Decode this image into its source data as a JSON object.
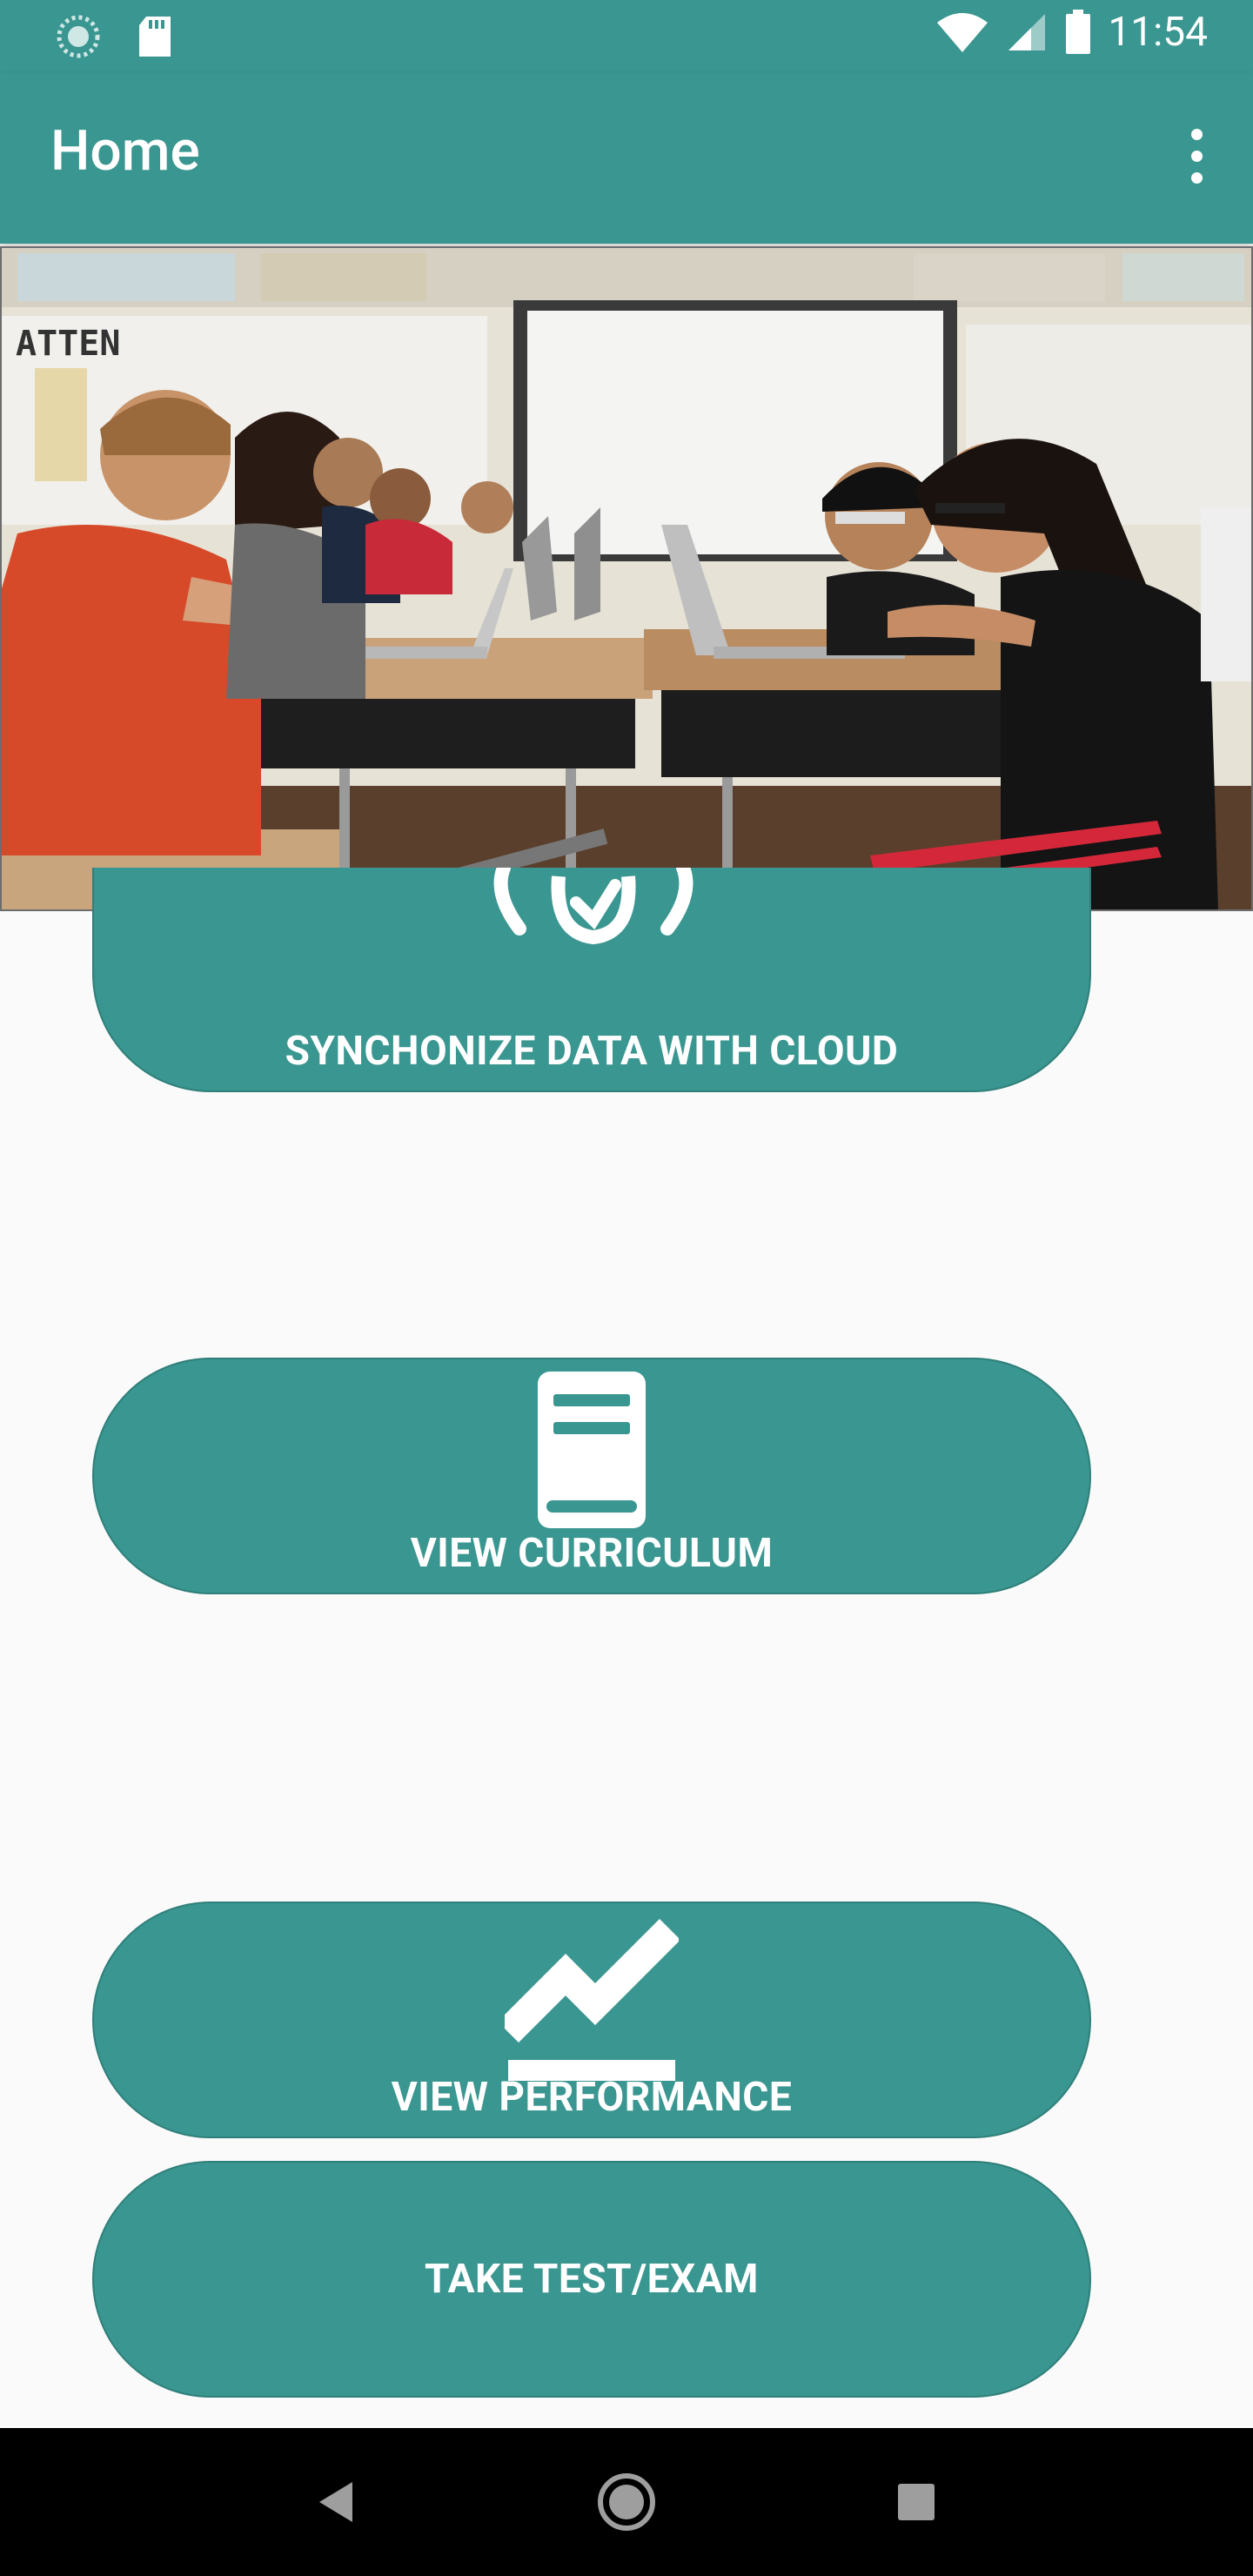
{
  "status_bar": {
    "time": "11:54",
    "icons": [
      "sync-notification-icon",
      "sd-card-icon",
      "wifi-icon",
      "cell-signal-icon",
      "battery-icon"
    ]
  },
  "app_bar": {
    "title": "Home",
    "menu_icon": "more-vert-icon"
  },
  "hero": {
    "image": "classroom-students-laptops-photo"
  },
  "buttons": {
    "sync": {
      "label": "SYNCHONIZE DATA WITH CLOUD",
      "icon": "cloud-sync-icon"
    },
    "curriculum": {
      "label": "VIEW CURRICULUM",
      "icon": "book-icon"
    },
    "performance": {
      "label": "VIEW PERFORMANCE",
      "icon": "trending-up-icon"
    },
    "test": {
      "label": "TAKE TEST/EXAM"
    }
  },
  "nav_bar": {
    "icons": [
      "back-icon",
      "home-icon",
      "recents-icon"
    ]
  },
  "colors": {
    "primary": "#3a9690",
    "background": "#fafafa",
    "nav": "#000000"
  }
}
